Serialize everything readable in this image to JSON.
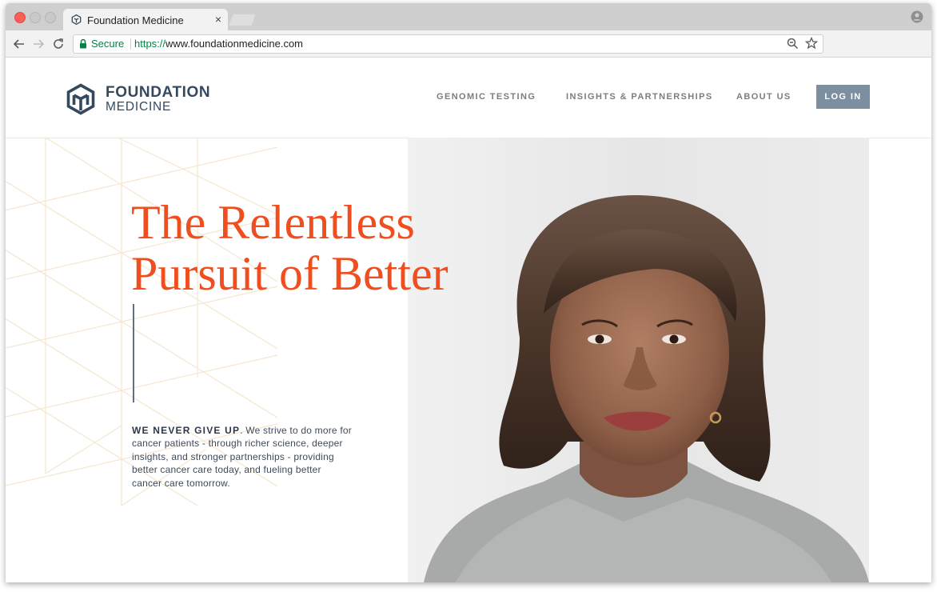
{
  "browser": {
    "tab": {
      "title": "Foundation Medicine",
      "close_glyph": "×",
      "favicon": "foundation-medicine-logo-icon"
    },
    "address_bar": {
      "secure_label": "Secure",
      "url_scheme": "https://",
      "url_rest": "www.foundationmedicine.com"
    },
    "colors": {
      "secure": "#0b8043",
      "close_button": "#fc5f57"
    }
  },
  "header": {
    "logo": {
      "line1": "FOUNDATION",
      "line2": "MEDICINE"
    },
    "nav": {
      "genomic_testing": "GENOMIC TESTING",
      "insights": "INSIGHTS & PARTNERSHIPS",
      "about": "ABOUT US"
    },
    "login_label": "LOG IN"
  },
  "hero": {
    "headline_line1": "The Relentless",
    "headline_line2": "Pursuit of Better",
    "lead": "WE NEVER GIVE UP",
    "body": ". We strive to do more for cancer patients - through richer science, deeper insights, and stronger partnerships - providing better cancer care today, and fueling better cancer care tomorrow.",
    "image": "portrait-photo"
  },
  "colors": {
    "brand_navy": "#34495e",
    "headline_orange": "#f04e1e",
    "login_button": "#7b8fa0",
    "pattern_lines": "#f6e6cf"
  }
}
